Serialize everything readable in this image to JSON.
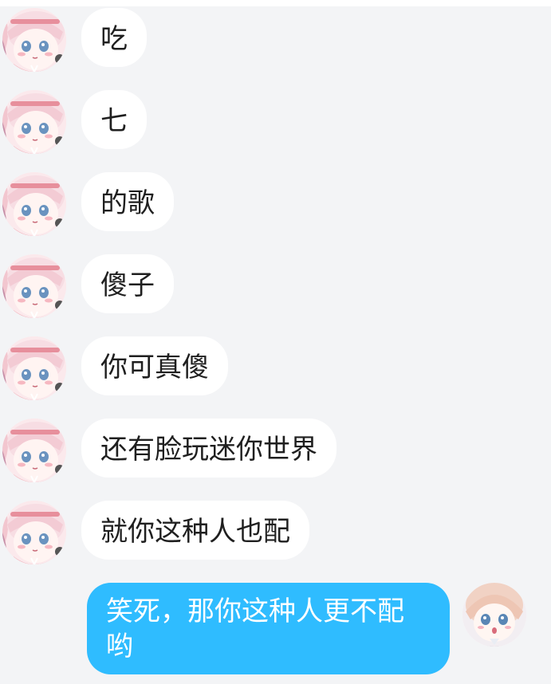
{
  "chat": {
    "messages": [
      {
        "text": "吃",
        "sender": "other",
        "avatar_icon": "anime-girl-pink-hair-avatar"
      },
      {
        "text": "七",
        "sender": "other",
        "avatar_icon": "anime-girl-pink-hair-avatar"
      },
      {
        "text": "的歌",
        "sender": "other",
        "avatar_icon": "anime-girl-pink-hair-avatar"
      },
      {
        "text": "傻子",
        "sender": "other",
        "avatar_icon": "anime-girl-pink-hair-avatar"
      },
      {
        "text": "你可真傻",
        "sender": "other",
        "avatar_icon": "anime-girl-pink-hair-avatar"
      },
      {
        "text": "还有脸玩迷你世界",
        "sender": "other",
        "avatar_icon": "anime-girl-pink-hair-avatar"
      },
      {
        "text": "就你这种人也配",
        "sender": "other",
        "avatar_icon": "anime-girl-pink-hair-avatar"
      },
      {
        "text": "笑死，那你这种人更不配哟",
        "sender": "me",
        "avatar_icon": "anime-girl-blonde-hair-avatar"
      }
    ]
  },
  "colors": {
    "background": "#f3f4f6",
    "incoming_bubble": "#ffffff",
    "outgoing_bubble": "#2fbcff",
    "incoming_text": "#1f1f1f",
    "outgoing_text": "#ffffff"
  }
}
